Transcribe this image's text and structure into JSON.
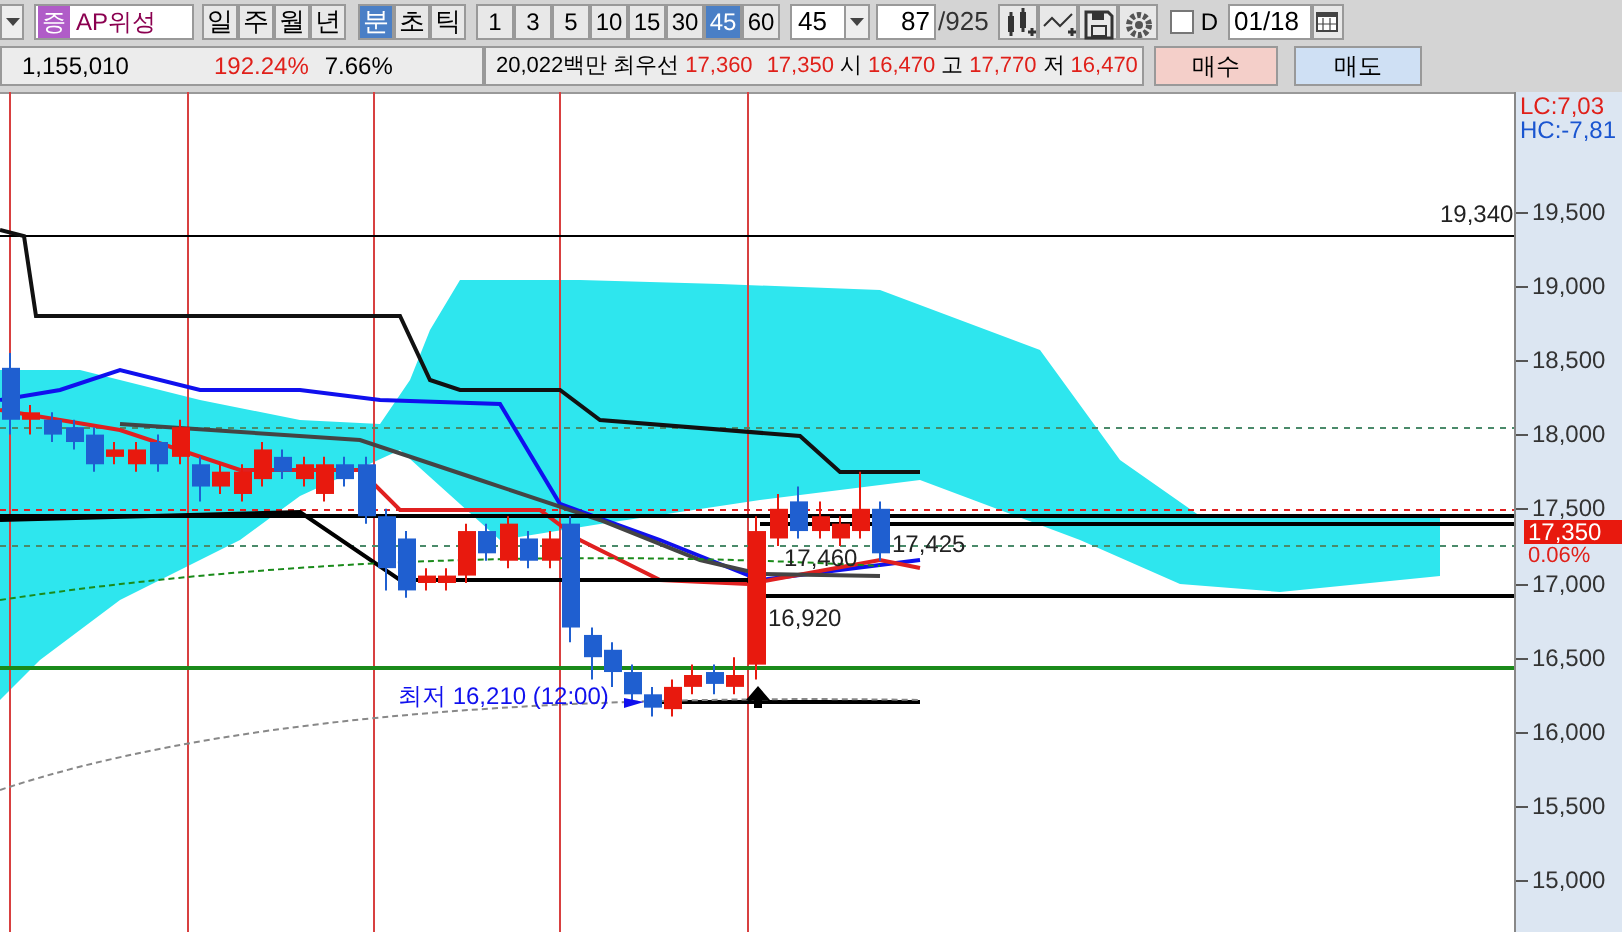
{
  "toolbar": {
    "symbol_badge": "증",
    "symbol": "AP위성",
    "period_buttons": [
      {
        "label": "일",
        "selected": false
      },
      {
        "label": "주",
        "selected": false
      },
      {
        "label": "월",
        "selected": false
      },
      {
        "label": "년",
        "selected": false
      }
    ],
    "unit_buttons": [
      {
        "label": "분",
        "selected": true
      },
      {
        "label": "초",
        "selected": false
      },
      {
        "label": "틱",
        "selected": false
      }
    ],
    "interval_buttons": [
      {
        "label": "1",
        "selected": false
      },
      {
        "label": "3",
        "selected": false
      },
      {
        "label": "5",
        "selected": false
      },
      {
        "label": "10",
        "selected": false
      },
      {
        "label": "15",
        "selected": false
      },
      {
        "label": "30",
        "selected": false
      },
      {
        "label": "45",
        "selected": true
      },
      {
        "label": "60",
        "selected": false
      }
    ],
    "interval_select": "45",
    "bar_index": "87",
    "bar_total": "/925",
    "d_checkbox": {
      "label": "D",
      "checked": false
    },
    "date": "01/18"
  },
  "quote_bar": {
    "volume": "1,155,010",
    "change_rate": "192.24%",
    "turnover_rate": "7.66%",
    "amount": "20,022백만",
    "best_label": "최우선",
    "best_ask": "17,360",
    "best_bid": "17,350",
    "prices": [
      {
        "label": "시",
        "value": "16,470"
      },
      {
        "label": "고",
        "value": "17,770"
      },
      {
        "label": "저",
        "value": "16,470"
      }
    ],
    "buy_button": "매수",
    "sell_button": "매도"
  },
  "chart": {
    "annotations": [
      "19,340",
      "17,460",
      "17,425",
      "16,920"
    ],
    "low_label": "최저 16,210 (12:00)",
    "axis": {
      "lc": "LC:7,03",
      "hc": "HC:-7,81",
      "ticks": [
        "19,500",
        "19,000",
        "18,500",
        "18,000",
        "17,500",
        "17,000",
        "16,500",
        "16,000",
        "15,500",
        "15,000"
      ],
      "current_price": "17,350",
      "current_change": "0.06%"
    }
  }
}
